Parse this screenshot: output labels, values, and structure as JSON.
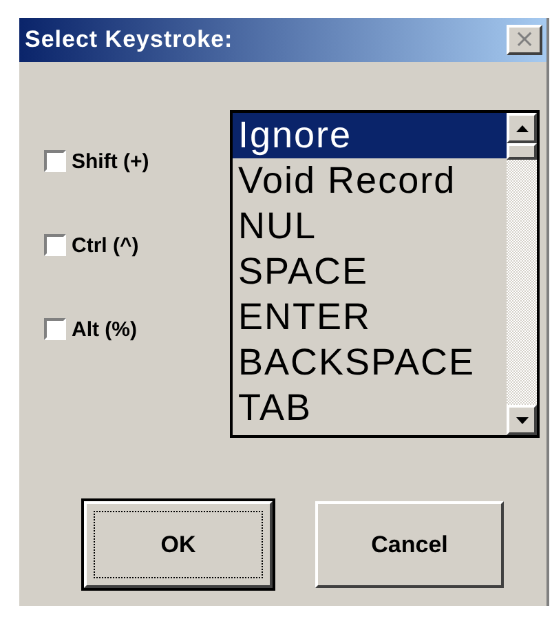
{
  "window": {
    "title": "Select Keystroke:",
    "close": "×"
  },
  "modifiers": [
    {
      "label": "Shift (+)",
      "checked": false
    },
    {
      "label": "Ctrl (^)",
      "checked": false
    },
    {
      "label": "Alt (%)",
      "checked": false
    }
  ],
  "keystrokes": [
    {
      "label": "Ignore",
      "selected": true
    },
    {
      "label": "Void Record",
      "selected": false
    },
    {
      "label": "NUL",
      "selected": false
    },
    {
      "label": "SPACE",
      "selected": false
    },
    {
      "label": "ENTER",
      "selected": false
    },
    {
      "label": "BACKSPACE",
      "selected": false
    },
    {
      "label": "TAB",
      "selected": false
    }
  ],
  "buttons": [
    {
      "label": "OK",
      "focused": true
    },
    {
      "label": "Cancel",
      "focused": false
    }
  ]
}
